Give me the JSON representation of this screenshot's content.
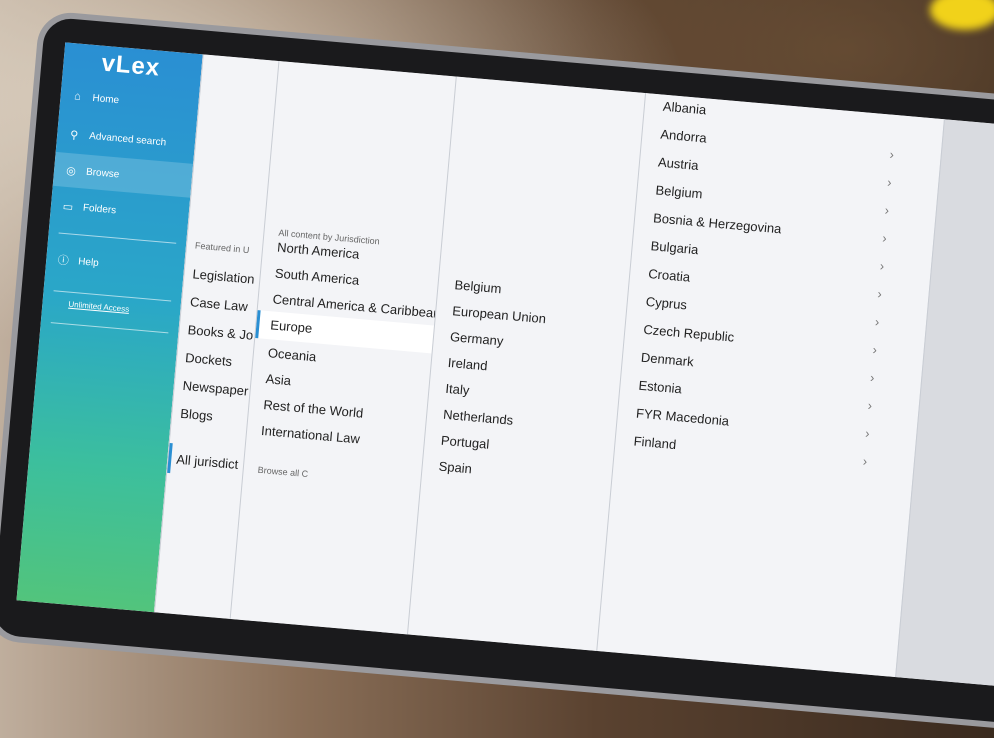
{
  "app": {
    "logo": "vLex"
  },
  "sidebar": {
    "items": [
      {
        "label": "Home",
        "icon": "home-icon"
      },
      {
        "label": "Advanced search",
        "icon": "search-icon"
      },
      {
        "label": "Browse",
        "icon": "compass-icon"
      },
      {
        "label": "Folders",
        "icon": "folder-icon"
      },
      {
        "label": "Help",
        "icon": "help-icon"
      }
    ],
    "unlimited": "Unlimited Access"
  },
  "col1": {
    "heading": "Featured in U",
    "items": [
      "Legislation",
      "Case Law",
      "Books & Jo",
      "Dockets",
      "Newspaper",
      "Blogs"
    ],
    "footer": "All jurisdict"
  },
  "col2": {
    "heading": "All content by Jurisdiction",
    "items": [
      "North America",
      "South America",
      "Central America & Caribbean",
      "Europe",
      "Oceania",
      "Asia",
      "Rest of the World",
      "International Law"
    ],
    "selected": "Europe",
    "footer": "Browse all C"
  },
  "col3": {
    "items": [
      "Belgium",
      "European Union",
      "Germany",
      "Ireland",
      "Italy",
      "Netherlands",
      "Portugal",
      "Spain"
    ]
  },
  "col4": {
    "items": [
      "Albania",
      "Andorra",
      "Austria",
      "Belgium",
      "Bosnia & Herzegovina",
      "Bulgaria",
      "Croatia",
      "Cyprus",
      "Czech Republic",
      "Denmark",
      "Estonia",
      "FYR Macedonia",
      "Finland"
    ]
  },
  "colors": {
    "accent": "#2a8fd3",
    "sidebar_bottom": "#52c47c"
  }
}
